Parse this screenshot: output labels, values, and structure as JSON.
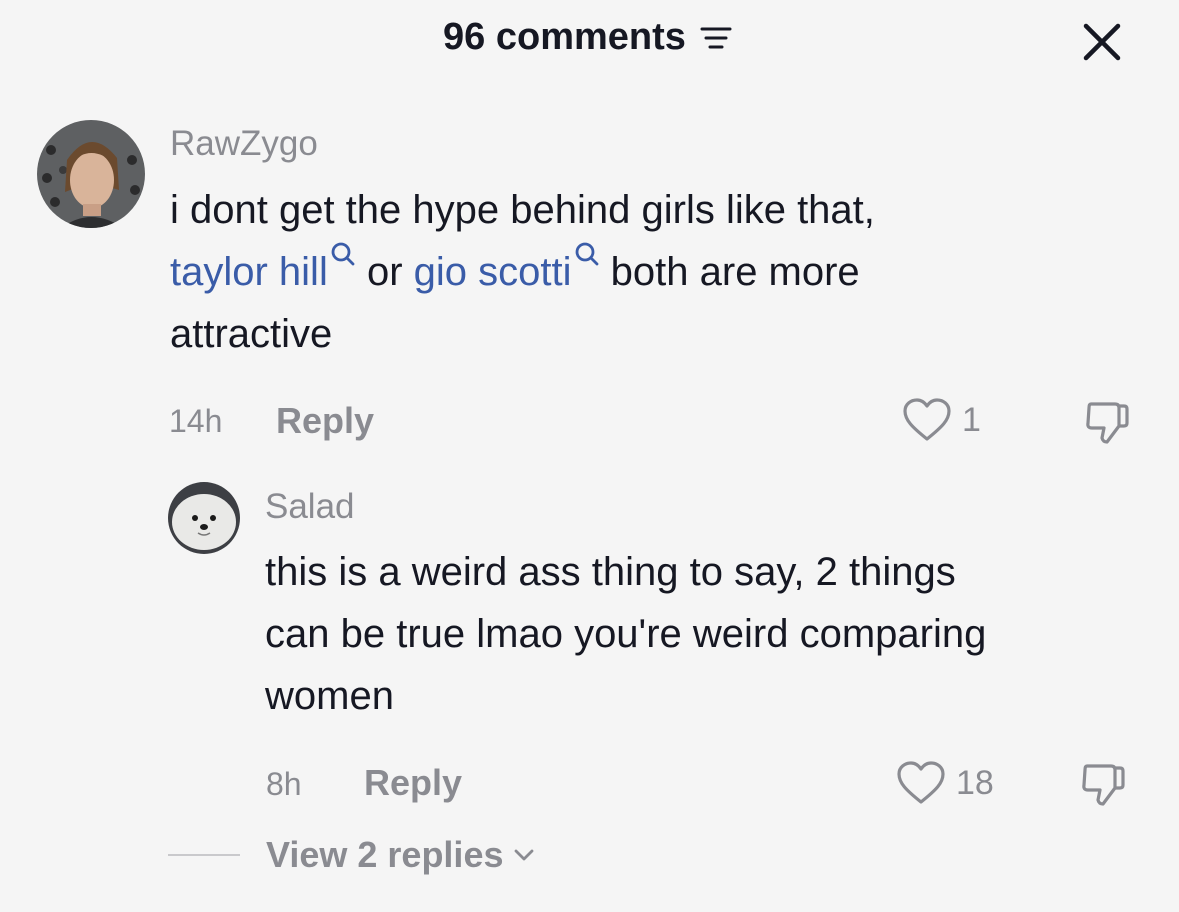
{
  "header": {
    "title": "96 comments",
    "filter_icon": "filter-lines-icon",
    "close_icon": "close-x-icon"
  },
  "comments": [
    {
      "username": "RawZygo",
      "text_line1": "i dont get the hype behind girls like that,",
      "mention1": "taylor hill",
      "between": "or",
      "mention2": "gio scotti",
      "after": "both are more",
      "text_line3": "attractive",
      "time": "14h",
      "reply_label": "Reply",
      "likes": "1"
    },
    {
      "username": "Salad",
      "text_line1": "this is a weird ass thing to say, 2 things",
      "text_line2": "can be true lmao you're weird comparing",
      "text_line3": "women",
      "time": "8h",
      "reply_label": "Reply",
      "likes": "18"
    }
  ],
  "view_replies": {
    "label": "View 2 replies"
  },
  "colors": {
    "background": "#f5f5f5",
    "mention": "#3a5ca8",
    "muted": "#8a8b91",
    "text": "#161823"
  }
}
